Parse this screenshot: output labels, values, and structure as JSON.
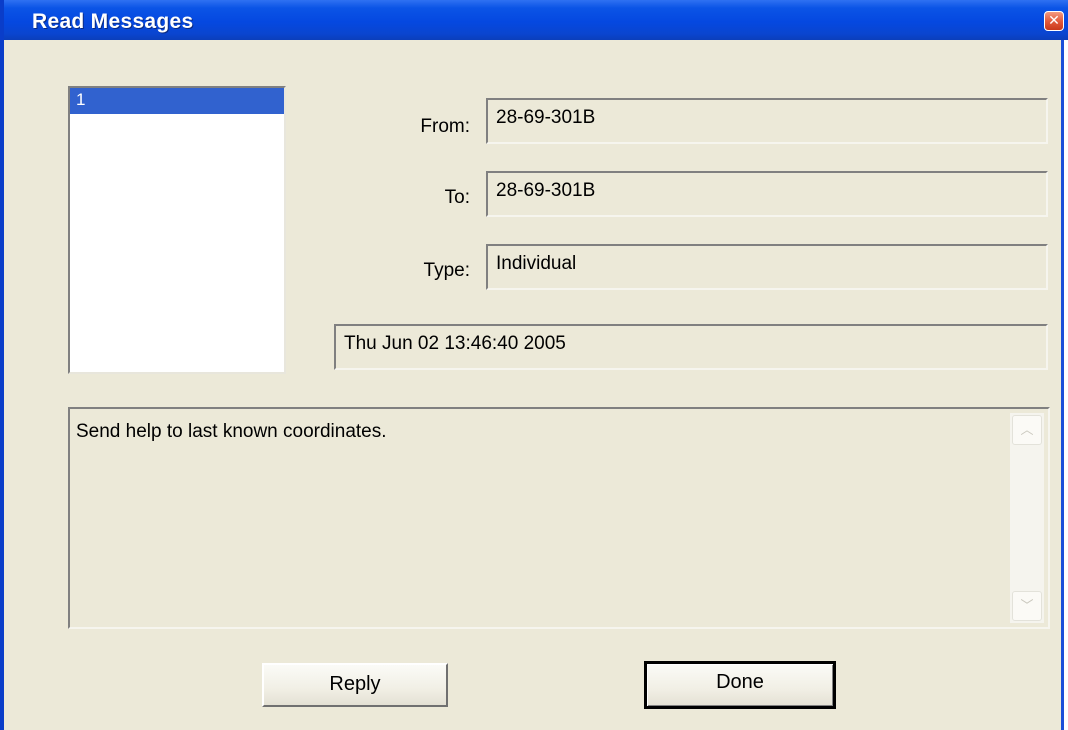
{
  "window": {
    "title": "Read Messages",
    "close_glyph": "✕"
  },
  "message_list": {
    "items": [
      "1"
    ],
    "selected_index": 0
  },
  "fields": {
    "from_label": "From:",
    "from_value": "28-69-301B",
    "to_label": "To:",
    "to_value": "28-69-301B",
    "type_label": "Type:",
    "type_value": "Individual",
    "timestamp": "Thu Jun 02 13:46:40 2005"
  },
  "body": {
    "text": "Send help to last known coordinates.",
    "scroll_up_glyph": "︿",
    "scroll_down_glyph": "﹀"
  },
  "buttons": {
    "reply_label": "Reply",
    "done_label": "Done"
  },
  "colors": {
    "titlebar": "#0548E0",
    "dialog_background": "#ECE9D8",
    "selection": "#3162CF"
  }
}
